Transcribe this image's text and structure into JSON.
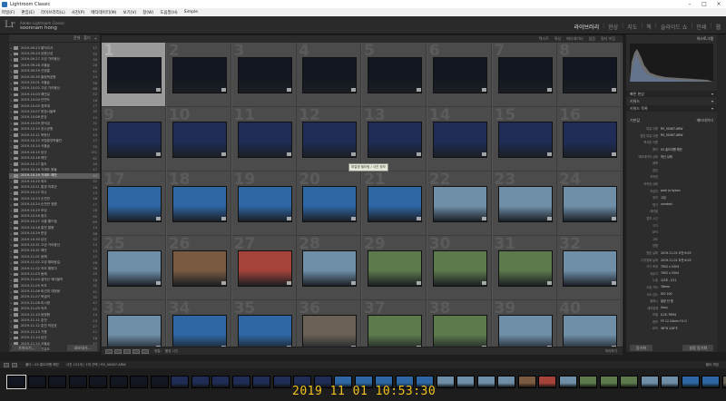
{
  "window": {
    "title": "Lightroom Classic"
  },
  "menu": [
    "파일(F)",
    "편집(E)",
    "라이브러리(L)",
    "사진(P)",
    "메타데이터(M)",
    "보기(V)",
    "창(W)",
    "도움말(H)",
    "Simple"
  ],
  "identity": {
    "catalog": "Adobe Lightroom Classic",
    "owner": "soonnam hong"
  },
  "modules": [
    "라이브러리",
    "현상",
    "지도",
    "책",
    "슬라이드 쇼",
    "인쇄",
    "웹"
  ],
  "left_panel": {
    "header": [
      "전체",
      "폴더"
    ],
    "folders": [
      {
        "name": "2019-09-23 팔덕이서",
        "count": "11"
      },
      {
        "name": "2019-09-24 남한산성",
        "count": "35"
      },
      {
        "name": "2019-09-27 고성 가리왕산",
        "count": "34"
      },
      {
        "name": "2019-09-28 서울숲",
        "count": "28"
      },
      {
        "name": "2019-09-29 선정릉",
        "count": "41"
      },
      {
        "name": "2019-09-30 올림픽공원",
        "count": "24"
      },
      {
        "name": "2019-10-01 서울숲",
        "count": "38"
      },
      {
        "name": "2019-10-02 고성 가리왕산",
        "count": "68"
      },
      {
        "name": "2019-10-03 해안길",
        "count": "52"
      },
      {
        "name": "2019-10-04 안면도",
        "count": "18"
      },
      {
        "name": "2019-10-05 경포대",
        "count": "77"
      },
      {
        "name": "2019-10-07 한강나들목",
        "count": "35"
      },
      {
        "name": "2019-10-08 한강",
        "count": "19"
      },
      {
        "name": "2019-10-09 창덕궁",
        "count": "31"
      },
      {
        "name": "2019-10-10 호수공원",
        "count": "19"
      },
      {
        "name": "2019-10-11 북한산",
        "count": "44"
      },
      {
        "name": "2019-10-12 국립중앙박물관",
        "count": "27"
      },
      {
        "name": "2019-10-14 서울숲",
        "count": "55"
      },
      {
        "name": "2019-10-15 남산",
        "count": "151"
      },
      {
        "name": "2019-10-16 해안",
        "count": "62"
      },
      {
        "name": "2019-10-17 홍도",
        "count": "34"
      },
      {
        "name": "2019-10-18 거제도 몽돌",
        "count": "47"
      },
      {
        "name": "2019-10-19 거제도 해안",
        "count": "68"
      },
      {
        "name": "2019-10-20 외도",
        "count": "32"
      },
      {
        "name": "2019-10-21 통영 미륵산",
        "count": "28"
      },
      {
        "name": "2019-10-22 여수",
        "count": "23"
      },
      {
        "name": "2019-10-23 순천만",
        "count": "46"
      },
      {
        "name": "2019-10-24 순천만 정원",
        "count": "77"
      },
      {
        "name": "2019-10-25 보성",
        "count": "28"
      },
      {
        "name": "2019-10-26 광주",
        "count": "55"
      },
      {
        "name": "2019-10-27 서울 월드컵",
        "count": "69"
      },
      {
        "name": "2019-10-28 홍천 팔봉",
        "count": "14"
      },
      {
        "name": "2019-10-29 한강",
        "count": "36"
      },
      {
        "name": "2019-10-30 남산",
        "count": "32"
      },
      {
        "name": "2019-10-31 고성 가리왕산",
        "count": "14"
      },
      {
        "name": "2019-10-31 해안",
        "count": "13"
      },
      {
        "name": "2019-11-01 동해",
        "count": "22"
      },
      {
        "name": "2019-11-02 고성 해파랑길",
        "count": "26"
      },
      {
        "name": "2019-11-02 속초 해맞이",
        "count": "38"
      },
      {
        "name": "2019-11-03 동해",
        "count": "29"
      },
      {
        "name": "2019-11-04 설악산 케이블카",
        "count": "18"
      },
      {
        "name": "2019-11-05 속초",
        "count": "32"
      },
      {
        "name": "2019-11-06 비선대 대청봉",
        "count": "41"
      },
      {
        "name": "2019-11-07 북설악",
        "count": "35"
      },
      {
        "name": "2019-11-08 미시령",
        "count": "47"
      },
      {
        "name": "2019-11-09 속초",
        "count": "52"
      },
      {
        "name": "2019-11-10 동명항",
        "count": "14"
      },
      {
        "name": "2019-11-11 춘천",
        "count": "23"
      },
      {
        "name": "2019-11-12 춘천 의암호",
        "count": "27"
      },
      {
        "name": "2019-11-13 가평",
        "count": "11"
      },
      {
        "name": "2019-11-14 남산",
        "count": "18"
      },
      {
        "name": "2019-11-15 서울숲",
        "count": "27"
      },
      {
        "name": "2019-11-16 선유도",
        "count": "13"
      },
      {
        "name": "2019-11-17 양재천",
        "count": "39"
      },
      {
        "name": "1000 / 10",
        "count": "131"
      },
      {
        "name": "송도해수욕장",
        "count": "39"
      }
    ],
    "selected_index": 22,
    "buttons": [
      "가져오기...",
      "내보내기..."
    ]
  },
  "top_toolbar": [
    "텍스트",
    "특성",
    "메타데이터",
    "없음",
    "필터 꺼짐"
  ],
  "grid": {
    "selected": 1,
    "cells": [
      {
        "n": "1",
        "tone": "night"
      },
      {
        "n": "2",
        "tone": "night"
      },
      {
        "n": "3",
        "tone": "night"
      },
      {
        "n": "4",
        "tone": "night"
      },
      {
        "n": "5",
        "tone": "night"
      },
      {
        "n": "6",
        "tone": "night"
      },
      {
        "n": "7",
        "tone": "night"
      },
      {
        "n": "8",
        "tone": "night"
      },
      {
        "n": "9",
        "tone": "dusk"
      },
      {
        "n": "10",
        "tone": "dusk"
      },
      {
        "n": "11",
        "tone": "dusk"
      },
      {
        "n": "12",
        "tone": "dusk"
      },
      {
        "n": "13",
        "tone": "dusk"
      },
      {
        "n": "14",
        "tone": "dusk"
      },
      {
        "n": "15",
        "tone": "dusk"
      },
      {
        "n": "16",
        "tone": "dusk"
      },
      {
        "n": "17",
        "tone": "blue"
      },
      {
        "n": "18",
        "tone": "blue"
      },
      {
        "n": "19",
        "tone": "blue"
      },
      {
        "n": "20",
        "tone": "blue"
      },
      {
        "n": "21",
        "tone": "blue"
      },
      {
        "n": "22",
        "tone": "day"
      },
      {
        "n": "23",
        "tone": "day"
      },
      {
        "n": "24",
        "tone": "day"
      },
      {
        "n": "25",
        "tone": "day"
      },
      {
        "n": "26",
        "tone": "warm"
      },
      {
        "n": "27",
        "tone": "red"
      },
      {
        "n": "28",
        "tone": "day"
      },
      {
        "n": "29",
        "tone": "green"
      },
      {
        "n": "30",
        "tone": "green"
      },
      {
        "n": "31",
        "tone": "green"
      },
      {
        "n": "32",
        "tone": "day"
      },
      {
        "n": "33",
        "tone": "day"
      },
      {
        "n": "34",
        "tone": "blue"
      },
      {
        "n": "35",
        "tone": "blue"
      },
      {
        "n": "36",
        "tone": "rock"
      },
      {
        "n": "37",
        "tone": "green"
      },
      {
        "n": "38",
        "tone": "green"
      },
      {
        "n": "39",
        "tone": "day"
      },
      {
        "n": "40",
        "tone": "day"
      }
    ]
  },
  "tooltip": "파일명 필터링 / 사진 정보",
  "bottom_toolbar": {
    "sort_label": "정렬:",
    "sort_value": "촬영 시간",
    "right": "미리보기"
  },
  "right_panel": {
    "header": "히스토그램",
    "rows": [
      {
        "label": "빠른 현상",
        "value": "▾"
      },
      {
        "label": "키워드",
        "value": "▾"
      },
      {
        "label": "키워드 목록",
        "value": "▾"
      },
      {
        "label": "기본값",
        "value": "메타데이터"
      }
    ],
    "metadata": [
      {
        "k": "파일 이름",
        "v": "R5_00467.ARW"
      },
      {
        "k": "원본 파일 이름",
        "v": "R5_00467.ARW"
      },
      {
        "k": "복사본 이름",
        "v": ""
      },
      {
        "k": "폴더",
        "v": "03 홍도여행 해안"
      },
      {
        "k": "메타데이터 상태",
        "v": "최신 상태"
      },
      {
        "k": "제목",
        "v": ""
      },
      {
        "k": "캡션",
        "v": ""
      },
      {
        "k": "저작권",
        "v": ""
      },
      {
        "k": "저작권 상태",
        "v": ""
      },
      {
        "k": "작성자",
        "v": "park ju kyeon"
      },
      {
        "k": "위치",
        "v": "고성"
      },
      {
        "k": "평가",
        "v": "unrated"
      },
      {
        "k": "레이블",
        "v": ""
      },
      {
        "k": "캡처 시간",
        "v": ""
      },
      {
        "k": "크기",
        "v": ""
      },
      {
        "k": "GPS",
        "v": ""
      },
      {
        "k": "고도",
        "v": ""
      },
      {
        "k": "방향",
        "v": ""
      },
      {
        "k": "원본 날짜",
        "v": "2019-11-01 오전 6:03"
      },
      {
        "k": "디지털화 날짜",
        "v": "2019-11-01 오전 6:03"
      },
      {
        "k": "크기 조정",
        "v": "7952 x 5304"
      },
      {
        "k": "자르기",
        "v": "7952 x 5304"
      },
      {
        "k": "노출",
        "v": "1/2초 - f/11"
      },
      {
        "k": "초점 거리",
        "v": "16mm"
      },
      {
        "k": "ISO 감도",
        "v": "ISO 100"
      },
      {
        "k": "플래시",
        "v": "발광 안 함"
      },
      {
        "k": "제조업체",
        "v": "Sony"
      },
      {
        "k": "모델",
        "v": "ILCE-7RM4"
      },
      {
        "k": "렌즈",
        "v": "FE 12-24mm F4 G"
      },
      {
        "k": "GPS",
        "v": "38°N 128°E"
      }
    ],
    "buttons": [
      "동기화",
      "설정 동기화"
    ]
  },
  "filmstrip_bar": {
    "left": "폴더 : 03 홍도여행 해안",
    "mid": "사진 151개 / 1개 선택 / R5_00467.ARW",
    "right": "필터 꺼짐"
  },
  "filmstrip_tones": [
    "night",
    "night",
    "night",
    "night",
    "night",
    "night",
    "night",
    "night",
    "dusk",
    "dusk",
    "dusk",
    "dusk",
    "dusk",
    "dusk",
    "dusk",
    "dusk",
    "blue",
    "blue",
    "blue",
    "blue",
    "blue",
    "day",
    "day",
    "day",
    "day",
    "warm",
    "red",
    "day",
    "green",
    "green",
    "green",
    "day",
    "day",
    "blue",
    "blue",
    "rock"
  ],
  "timestamp": "2019 11 01 10:53:30",
  "tones": {
    "night": "#121722",
    "dusk": "#1f2d56",
    "blue": "#2e67a4",
    "day": "#6f8fa9",
    "warm": "#7a5a40",
    "red": "#a5433b",
    "green": "#5d7a4c",
    "rock": "#6a6157"
  }
}
